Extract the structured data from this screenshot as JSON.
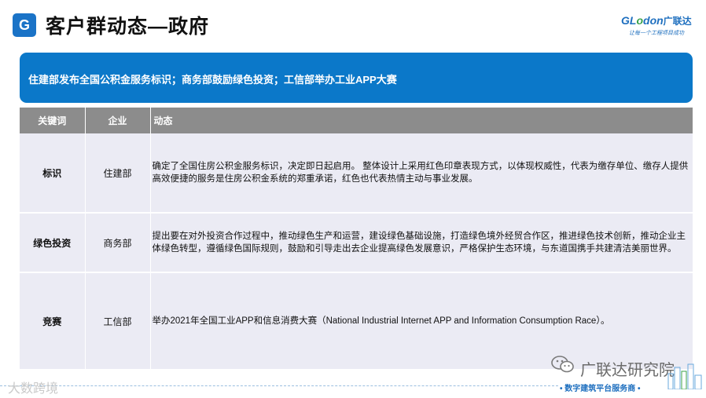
{
  "header": {
    "title": "客户群动态—政府",
    "logo_letter": "G",
    "brand": {
      "name_prefix": "GL",
      "name_o": "o",
      "name_suffix": "don",
      "name_cn": "广联达",
      "slogan": "让每一个工程项目成功"
    }
  },
  "banner": {
    "text": "住建部发布全国公积金服务标识；商务部鼓励绿色投资；工信部举办工业APP大赛"
  },
  "table": {
    "headers": [
      "关键词",
      "企业",
      "动态"
    ],
    "rows": [
      {
        "keyword": "标识",
        "company": "住建部",
        "dynamic": "确定了全国住房公积金服务标识，决定即日起启用。  整体设计上采用红色印章表现方式，以体现权威性，代表为缴存单位、缴存人提供高效便捷的服务是住房公积金系统的郑重承诺，红色也代表热情主动与事业发展。"
      },
      {
        "keyword": "绿色投资",
        "company": "商务部",
        "dynamic": "提出要在对外投资合作过程中，推动绿色生产和运营，建设绿色基础设施，打造绿色境外经贸合作区，推进绿色技术创新，推动企业主体绿色转型，遵循绿色国际规则，鼓励和引导走出去企业提高绿色发展意识，严格保护生态环境，与东道国携手共建清洁美丽世界。"
      },
      {
        "keyword": "竞赛",
        "company": "工信部",
        "dynamic": "举办2021年全国工业APP和信息消费大赛（National Industrial Internet APP and Information Consumption Race）。"
      }
    ]
  },
  "footer": {
    "watermark": "大数跨境",
    "research": "广联达研究院",
    "tagline": "• 数字建筑平台服务商 •"
  },
  "colors": {
    "banner": "#0b78c9",
    "header_row": "#8c8c8c",
    "row_bg": "#ebebf4",
    "brand_blue": "#1e6fbf"
  }
}
